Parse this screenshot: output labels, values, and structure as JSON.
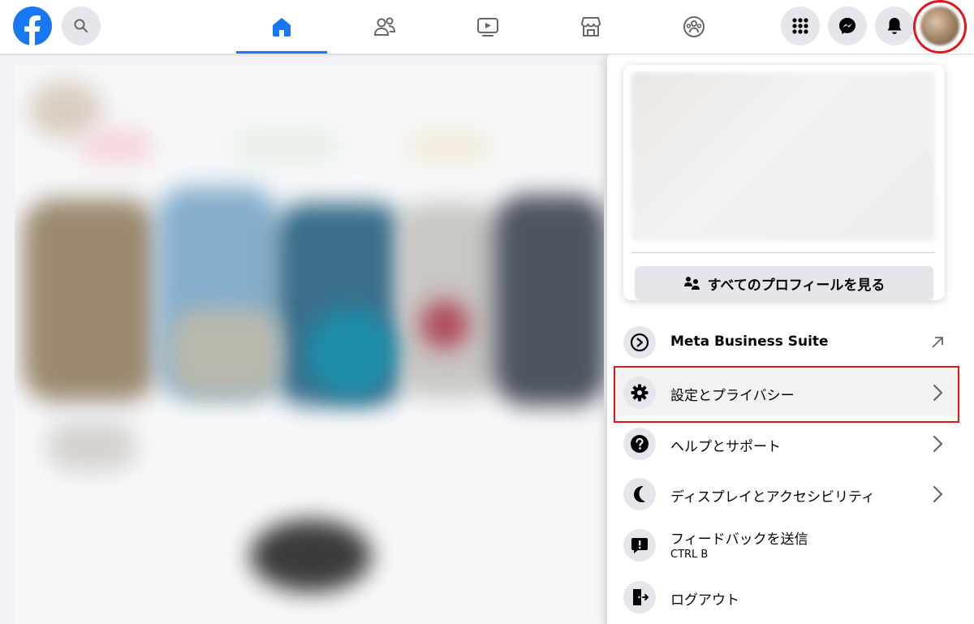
{
  "topbar": {
    "logo_icon": "facebook-logo",
    "search_icon": "search-icon",
    "tabs": [
      {
        "name": "home",
        "icon": "home-icon",
        "active": true
      },
      {
        "name": "friends",
        "icon": "friends-icon",
        "active": false
      },
      {
        "name": "watch",
        "icon": "video-icon",
        "active": false
      },
      {
        "name": "marketplace",
        "icon": "store-icon",
        "active": false
      },
      {
        "name": "groups",
        "icon": "groups-icon",
        "active": false
      }
    ],
    "right_icons": [
      "menu-grid-icon",
      "messenger-icon",
      "bell-icon",
      "avatar"
    ]
  },
  "dropdown": {
    "see_all_profiles_label": "すべてのプロフィールを見る",
    "items": [
      {
        "label": "Meta Business Suite",
        "icon": "meta-business-icon",
        "trailing": "external-link-icon"
      },
      {
        "label": "設定とプライバシー",
        "icon": "gear-icon",
        "trailing": "chevron-right-icon"
      },
      {
        "label": "ヘルプとサポート",
        "icon": "question-icon",
        "trailing": "chevron-right-icon"
      },
      {
        "label": "ディスプレイとアクセシビリティ",
        "icon": "moon-icon",
        "trailing": "chevron-right-icon"
      },
      {
        "label": "フィードバックを送信",
        "sublabel": "CTRL B",
        "icon": "feedback-icon",
        "trailing": ""
      },
      {
        "label": "ログアウト",
        "icon": "logout-icon",
        "trailing": ""
      }
    ]
  },
  "colors": {
    "brand": "#1877f2",
    "annotation": "#e8141c",
    "icon_bg": "#e4e6eb",
    "nav_icon": "#65676b"
  }
}
